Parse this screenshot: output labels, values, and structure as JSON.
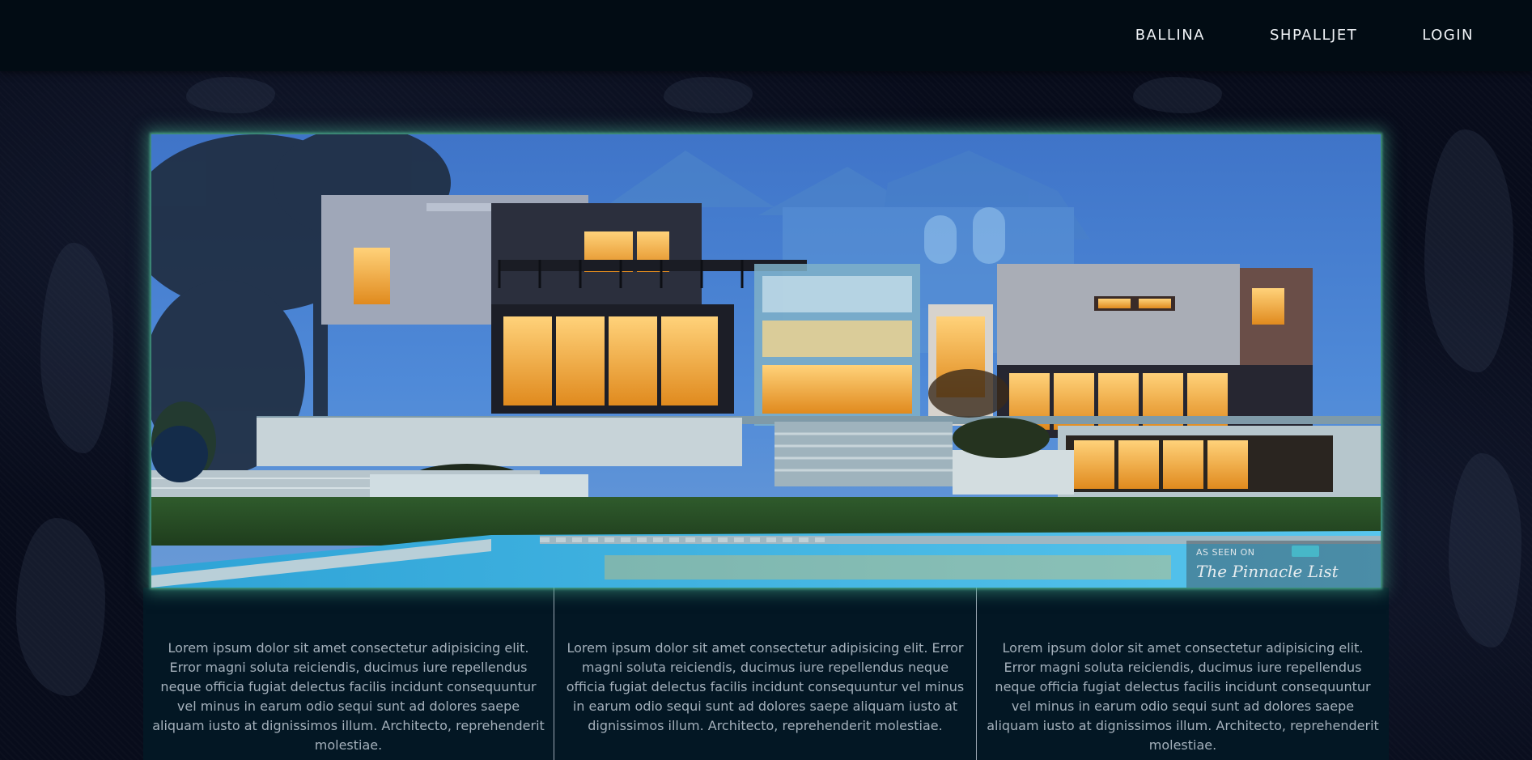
{
  "nav": {
    "items": [
      {
        "label": "BALLINA"
      },
      {
        "label": "SHPALLJET"
      },
      {
        "label": "LOGIN"
      }
    ]
  },
  "hero": {
    "watermark_line1": "AS SEEN ON",
    "watermark_line2": "The Pinnacle List"
  },
  "panels": [
    {
      "text": "Lorem ipsum dolor sit amet consectetur adipisicing elit. Error magni soluta reiciendis, ducimus iure repellendus neque officia fugiat delectus facilis incidunt consequuntur vel minus in earum odio sequi sunt ad dolores saepe aliquam iusto at dignissimos illum. Architecto, reprehenderit molestiae."
    },
    {
      "text": "Lorem ipsum dolor sit amet consectetur adipisicing elit. Error magni soluta reiciendis, ducimus iure repellendus neque officia fugiat delectus facilis incidunt consequuntur vel minus in earum odio sequi sunt ad dolores saepe aliquam iusto at dignissimos illum. Architecto, reprehenderit molestiae."
    },
    {
      "text": "Lorem ipsum dolor sit amet consectetur adipisicing elit. Error magni soluta reiciendis, ducimus iure repellendus neque officia fugiat delectus facilis incidunt consequuntur vel minus in earum odio sequi sunt ad dolores saepe aliquam iusto at dignissimos illum. Architecto, reprehenderit molestiae."
    }
  ],
  "colors": {
    "header_bg": "#020c14",
    "page_bg": "#080c1b",
    "panel_bg": "#031724",
    "glow": "#46aa8c",
    "nav_text": "#f1f4f8",
    "panel_text": "#a4b0bb"
  }
}
